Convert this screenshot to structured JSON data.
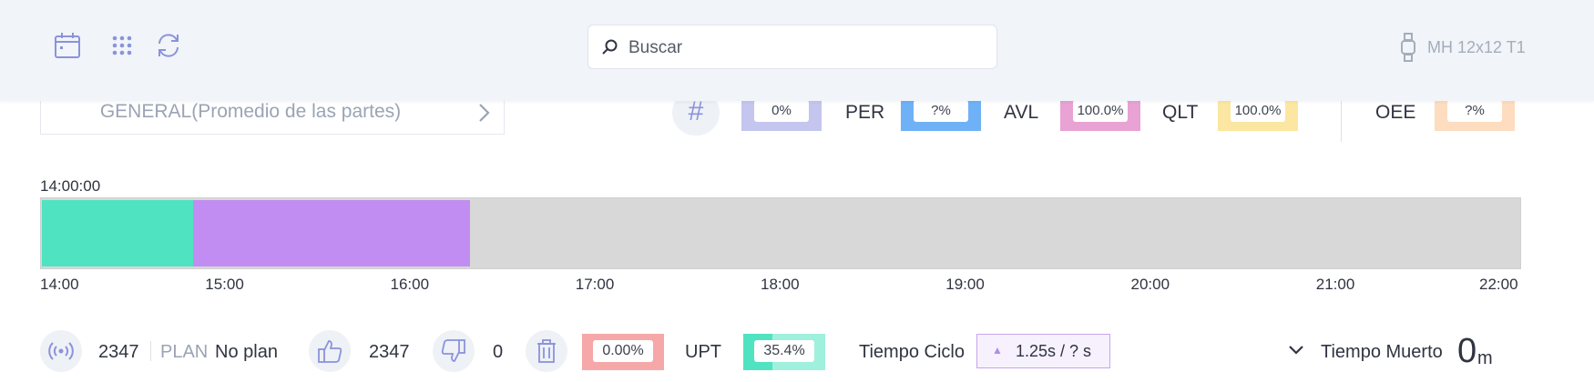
{
  "header": {
    "search_placeholder": "Buscar",
    "machine_name": "MH 12x12 T1",
    "icons": [
      "calendar-icon",
      "grid-icon",
      "refresh-icon",
      "search-icon",
      "watch-icon"
    ]
  },
  "selector": {
    "label": "GENERAL(Promedio de las partes)"
  },
  "metrics": {
    "count_value": "0%",
    "per_label": "PER",
    "per_value": "?%",
    "avl_label": "AVL",
    "avl_value": "100.0%",
    "qlt_label": "QLT",
    "qlt_value": "100.0%",
    "oee_label": "OEE",
    "oee_value": "?%",
    "colors": {
      "count": "#c4c6ef",
      "per": "#6fb1f6",
      "avl": "#e8a2d3",
      "qlt": "#fbe7a1",
      "oee": "#fddcbf"
    }
  },
  "timeline": {
    "start_label": "14:00:00",
    "ticks": [
      "14:00",
      "15:00",
      "16:00",
      "17:00",
      "18:00",
      "19:00",
      "20:00",
      "21:00",
      "22:00"
    ],
    "range_hours": [
      14,
      22
    ],
    "segments": [
      {
        "start": 14.0,
        "end": 14.82,
        "color": "#4fe3c1"
      },
      {
        "start": 14.82,
        "end": 16.32,
        "color": "#c28df2"
      }
    ],
    "background_color": "#d8d8d8"
  },
  "footer": {
    "produced_count": "2347",
    "plan_label": "PLAN",
    "plan_value": "No plan",
    "good_count": "2347",
    "bad_count": "0",
    "scrap_percent": "0.00%",
    "upt_label": "UPT",
    "upt_value": "35.4%",
    "upt_fraction": 0.354,
    "cycle_label": "Tiempo Ciclo",
    "cycle_value": "1.25s  /  ? s",
    "dead_time_label": "Tiempo Muerto",
    "dead_time_value": "0",
    "dead_time_unit": "m",
    "colors": {
      "scrap": "#f6a8a8",
      "upt_fill": "#4fe3c1",
      "upt_rest": "#9ff0dd"
    }
  }
}
